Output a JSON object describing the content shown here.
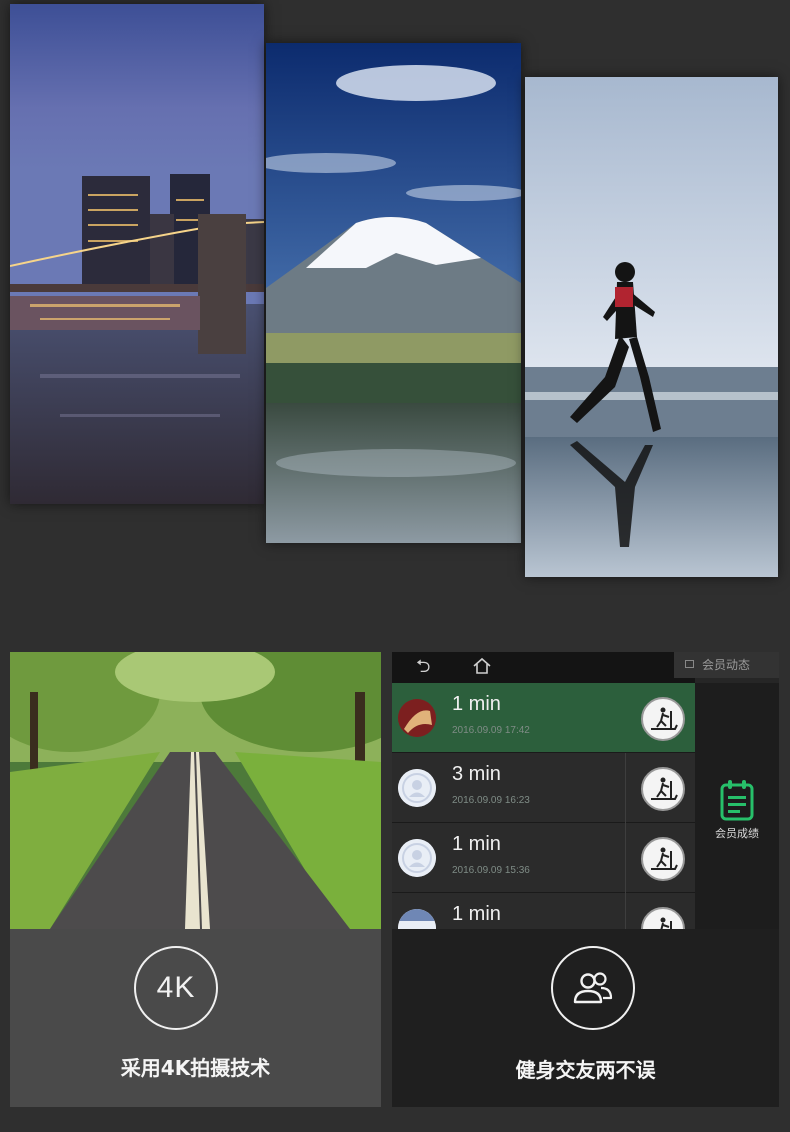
{
  "gallery": {
    "photos": [
      {
        "subject": "city-bridge-night"
      },
      {
        "subject": "snow-mountain-lake"
      },
      {
        "subject": "woman-running-beach"
      }
    ]
  },
  "features": [
    {
      "icon": "4k-badge-icon",
      "icon_text": "4K",
      "caption": "采用4K拍摄技术"
    },
    {
      "icon": "users-icon",
      "caption": "健身交友两不误"
    }
  ],
  "app": {
    "tab_label": "会员动态",
    "sidebar_label": "会员成绩",
    "nav_icons": [
      "back-icon",
      "home-icon"
    ],
    "accent": "#2c5f3c",
    "sidebar_icon_color": "#27c06a",
    "records": [
      {
        "duration": "1 min",
        "date": "2016.09.09  17:42",
        "active": true
      },
      {
        "duration": "3 min",
        "date": "2016.09.09  16:23",
        "active": false
      },
      {
        "duration": "1 min",
        "date": "2016.09.09  15:36",
        "active": false
      },
      {
        "duration": "1 min",
        "date": "",
        "active": false
      }
    ]
  }
}
